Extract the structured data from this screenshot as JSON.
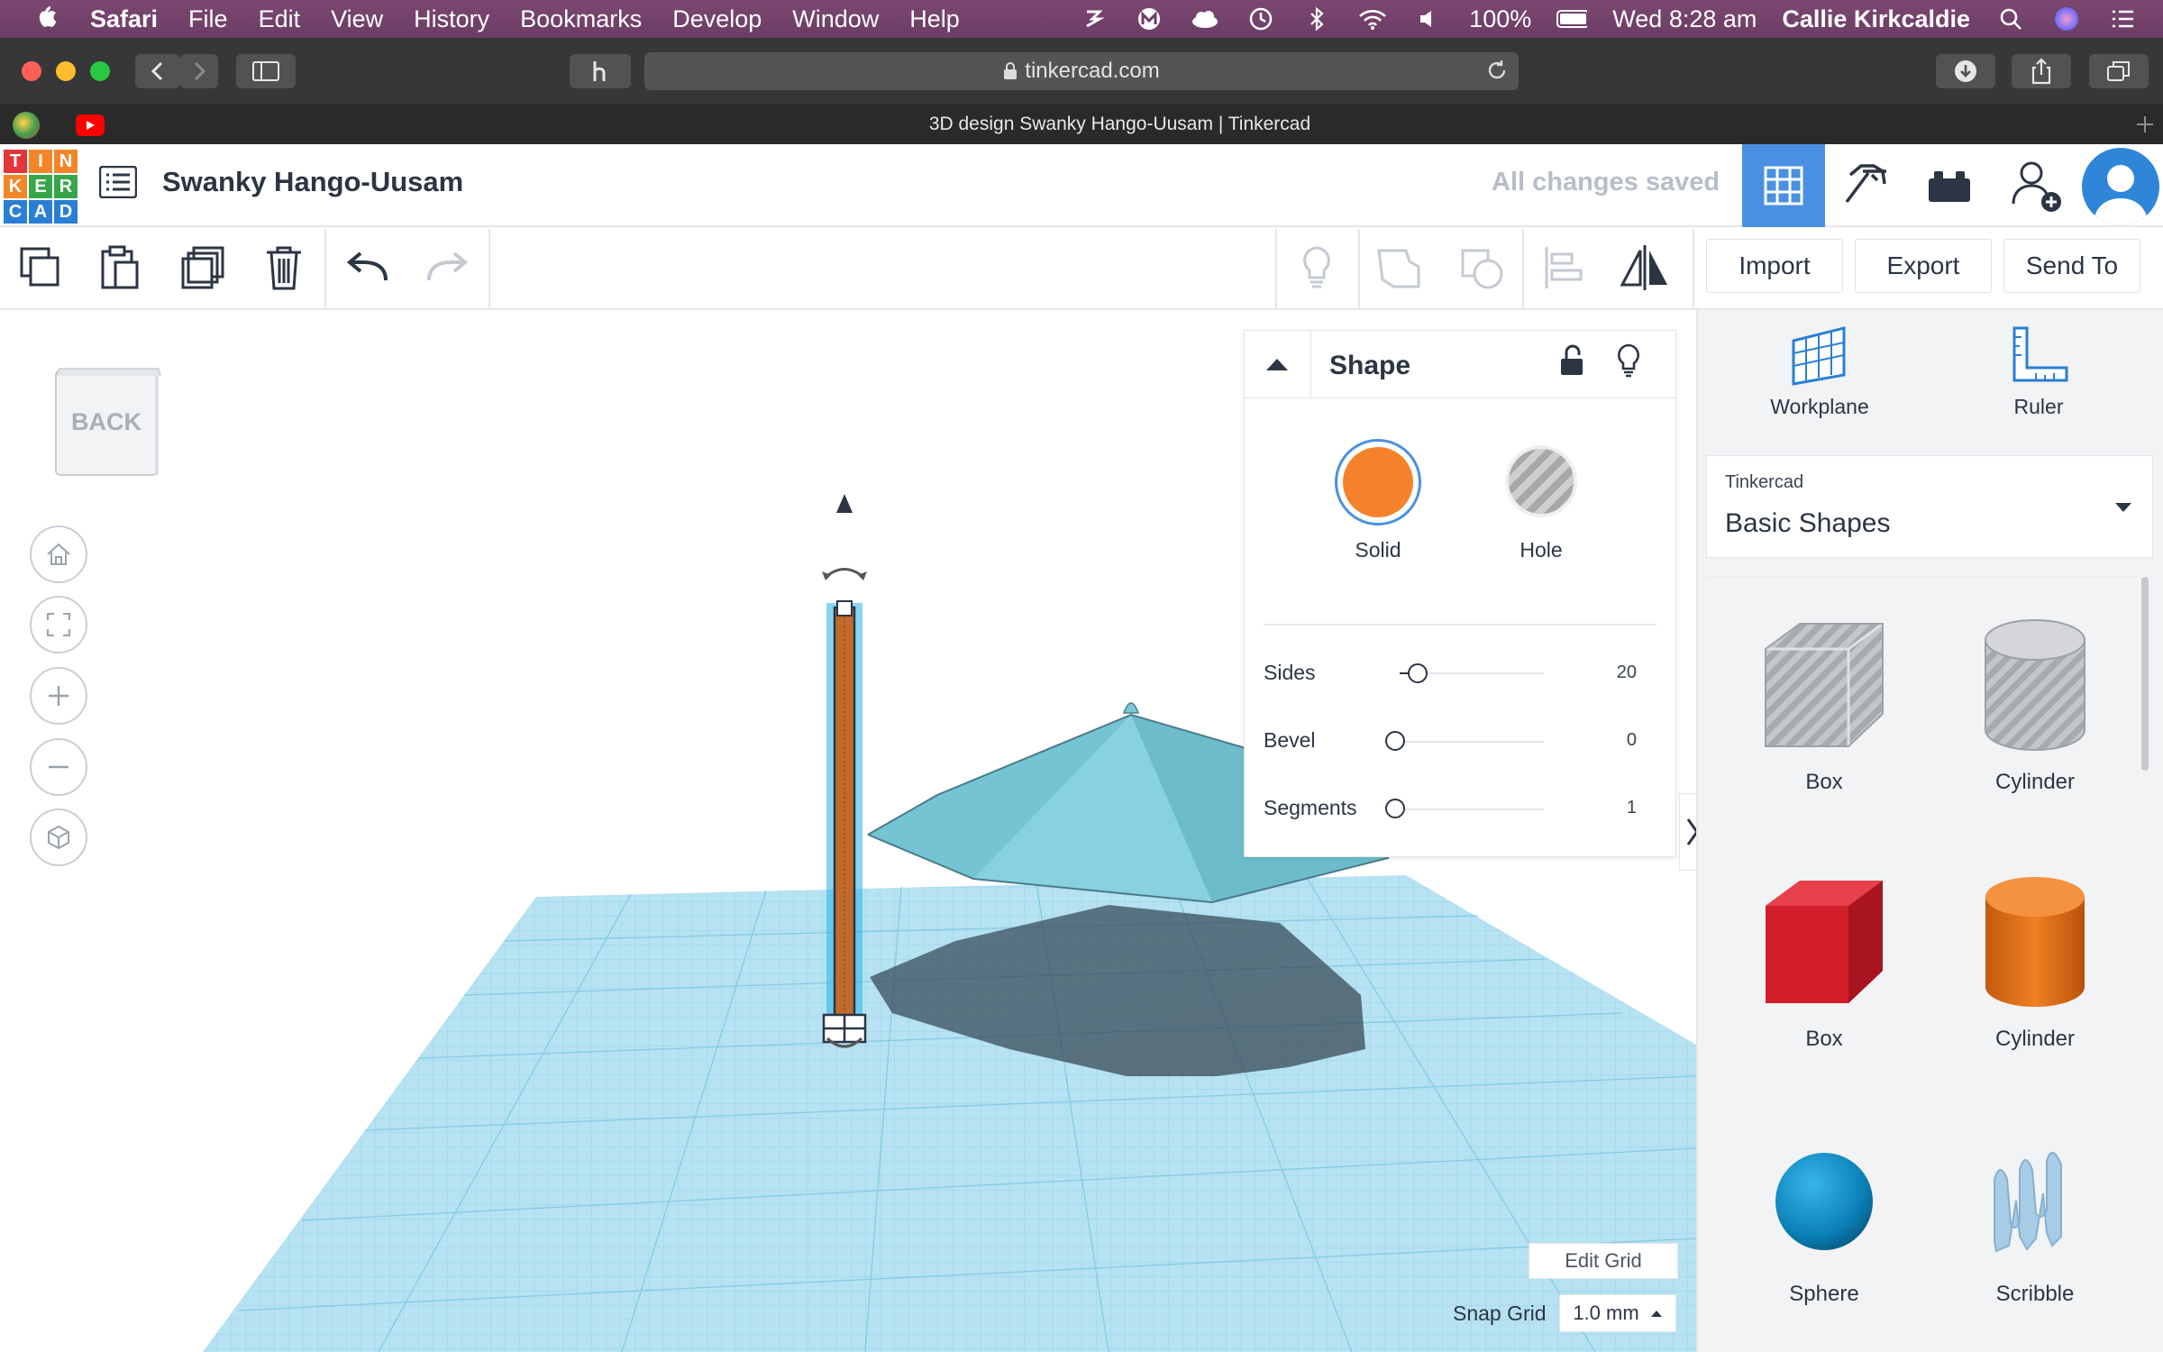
{
  "menubar": {
    "items": [
      "Safari",
      "File",
      "Edit",
      "View",
      "History",
      "Bookmarks",
      "Develop",
      "Window",
      "Help"
    ],
    "battery": "100%",
    "clock": "Wed 8:28 am",
    "user": "Callie Kirkcaldie"
  },
  "browser": {
    "url": "tinkercad.com",
    "tab_title": "3D design Swanky Hango-Uusam | Tinkercad"
  },
  "header": {
    "logo_letters": [
      "T",
      "I",
      "N",
      "K",
      "E",
      "R",
      "C",
      "A",
      "D"
    ],
    "design_title": "Swanky Hango-Uusam",
    "save_status": "All changes saved"
  },
  "toolbar": {
    "import_label": "Import",
    "export_label": "Export",
    "send_label": "Send To"
  },
  "viewcube": {
    "label": "BACK"
  },
  "inspector": {
    "title": "Shape",
    "solid_label": "Solid",
    "hole_label": "Hole",
    "solid_color": "#f5822a",
    "params": [
      {
        "label": "Sides",
        "value": "20",
        "fraction": 0.12
      },
      {
        "label": "Bevel",
        "value": "0",
        "fraction": 0.0
      },
      {
        "label": "Segments",
        "value": "1",
        "fraction": 0.0
      }
    ]
  },
  "library": {
    "workplane_label": "Workplane",
    "ruler_label": "Ruler",
    "source": "Tinkercad",
    "category": "Basic Shapes",
    "shapes": [
      {
        "label": "Box",
        "icon": "box-hole-icon"
      },
      {
        "label": "Cylinder",
        "icon": "cylinder-hole-icon"
      },
      {
        "label": "Box",
        "icon": "box-solid-icon"
      },
      {
        "label": "Cylinder",
        "icon": "cylinder-solid-icon"
      },
      {
        "label": "Sphere",
        "icon": "sphere-icon"
      },
      {
        "label": "Scribble",
        "icon": "scribble-icon"
      }
    ]
  },
  "grid": {
    "edit_label": "Edit Grid",
    "snap_label": "Snap Grid",
    "snap_value": "1.0 mm"
  },
  "colors": {
    "brand_blue": "#4a90e2",
    "workplane": "#a9dcee",
    "selection": "#1fb3e0"
  }
}
